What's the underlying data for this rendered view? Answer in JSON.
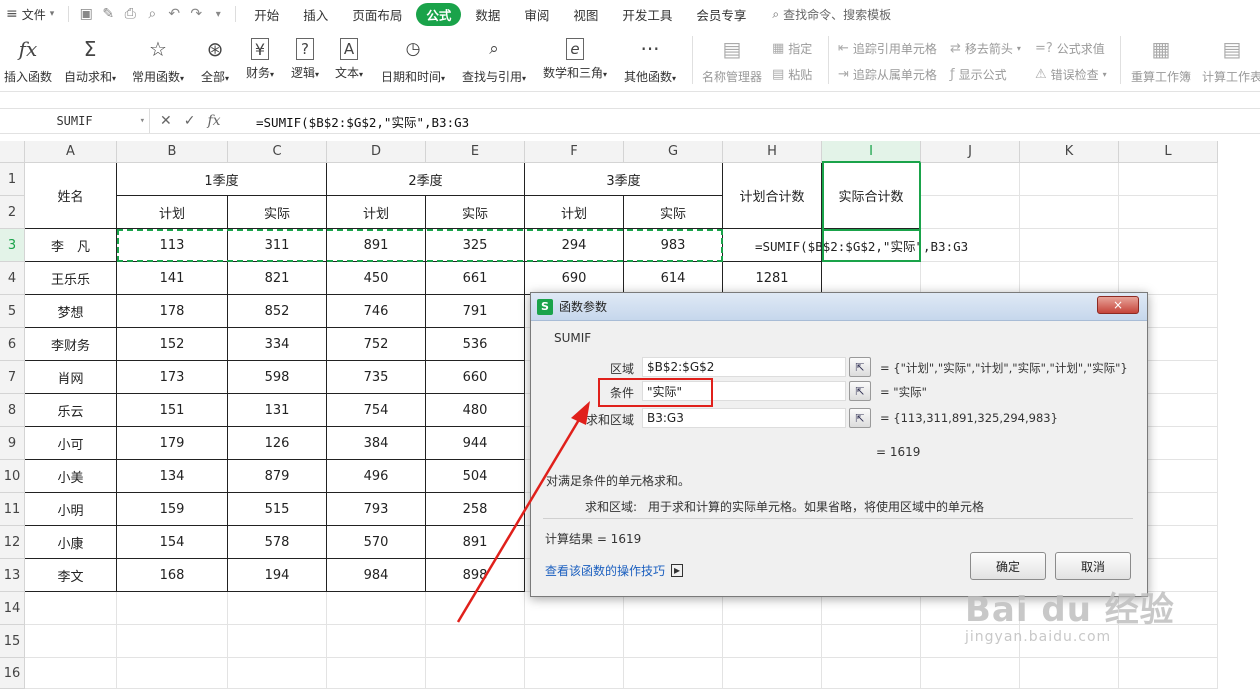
{
  "menubar": {
    "file": "文件",
    "tabs": [
      "开始",
      "插入",
      "页面布局",
      "公式",
      "数据",
      "审阅",
      "视图",
      "开发工具",
      "会员专享"
    ],
    "active_tab": "公式",
    "search": "查找命令、搜索模板"
  },
  "ribbon": {
    "insert_function": "插入函数",
    "autosum": "自动求和",
    "common_functions": "常用函数",
    "all": "全部",
    "finance": "财务",
    "logic": "逻辑",
    "text": "文本",
    "datetime": "日期和时间",
    "lookup": "查找与引用",
    "math": "数学和三角",
    "other": "其他函数",
    "name_manager": "名称管理器",
    "define": "指定",
    "paste": "粘贴",
    "trace_precedents": "追踪引用单元格",
    "trace_dependents": "追踪从属单元格",
    "remove_arrows": "移去箭头",
    "show_formulas": "显示公式",
    "formula_eval": "公式求值",
    "error_check": "错误检查",
    "recalc_workbook": "重算工作簿",
    "calc_workbook": "计算工作表"
  },
  "formula_bar": {
    "name_box": "SUMIF",
    "formula": "=SUMIF($B$2:$G$2,\"实际\",B3:G3"
  },
  "columns": [
    "A",
    "B",
    "C",
    "D",
    "E",
    "F",
    "G",
    "H",
    "I",
    "J",
    "K",
    "L"
  ],
  "rows": [
    "1",
    "2",
    "3",
    "4",
    "5",
    "6",
    "7",
    "8",
    "9",
    "10",
    "11",
    "12",
    "13",
    "14",
    "15",
    "16"
  ],
  "sheet": {
    "name_header": "姓名",
    "q1": "1季度",
    "q2": "2季度",
    "q3": "3季度",
    "plan": "计划",
    "actual": "实际",
    "plan_total": "计划合计数",
    "actual_total": "实际合计数",
    "editing_formula": "=SUMIF($B$2:$G$2,\"实际\",B3:G3",
    "h4": "1281",
    "data": [
      [
        "李　凡",
        "113",
        "311",
        "891",
        "325",
        "294",
        "983"
      ],
      [
        "王乐乐",
        "141",
        "821",
        "450",
        "661",
        "690",
        "614"
      ],
      [
        "梦想",
        "178",
        "852",
        "746",
        "791",
        "",
        ""
      ],
      [
        "李财务",
        "152",
        "334",
        "752",
        "536",
        "",
        ""
      ],
      [
        "肖网",
        "173",
        "598",
        "735",
        "660",
        "",
        ""
      ],
      [
        "乐云",
        "151",
        "131",
        "754",
        "480",
        "",
        ""
      ],
      [
        "小可",
        "179",
        "126",
        "384",
        "944",
        "",
        ""
      ],
      [
        "小美",
        "134",
        "879",
        "496",
        "504",
        "",
        ""
      ],
      [
        "小明",
        "159",
        "515",
        "793",
        "258",
        "",
        ""
      ],
      [
        "小康",
        "154",
        "578",
        "570",
        "891",
        "",
        ""
      ],
      [
        "李文",
        "168",
        "194",
        "984",
        "898",
        "",
        ""
      ]
    ]
  },
  "dialog": {
    "title": "函数参数",
    "close": "×",
    "function_name": "SUMIF",
    "args": [
      {
        "label": "区域",
        "value": "$B$2:$G$2",
        "result": "= {\"计划\",\"实际\",\"计划\",\"实际\",\"计划\",\"实际\"}"
      },
      {
        "label": "条件",
        "value": "\"实际\"",
        "result": "= \"实际\""
      },
      {
        "label": "求和区域",
        "value": "B3:G3",
        "result": "= {113,311,891,325,294,983}"
      }
    ],
    "formula_result": "= 1619",
    "description": "对满足条件的单元格求和。",
    "arg_help_label": "求和区域:",
    "arg_help_text": "用于求和计算的实际单元格。如果省略，将使用区域中的单元格",
    "calc_result": "计算结果 = 1619",
    "help_link": "查看该函数的操作技巧",
    "ok": "确定",
    "cancel": "取消"
  },
  "watermark": {
    "line1": "Bai du 经验",
    "line2": "jingyan.baidu.com"
  },
  "colors": {
    "accent": "#1aa34a",
    "highlight": "#e0201b",
    "link": "#1b5fbf"
  }
}
